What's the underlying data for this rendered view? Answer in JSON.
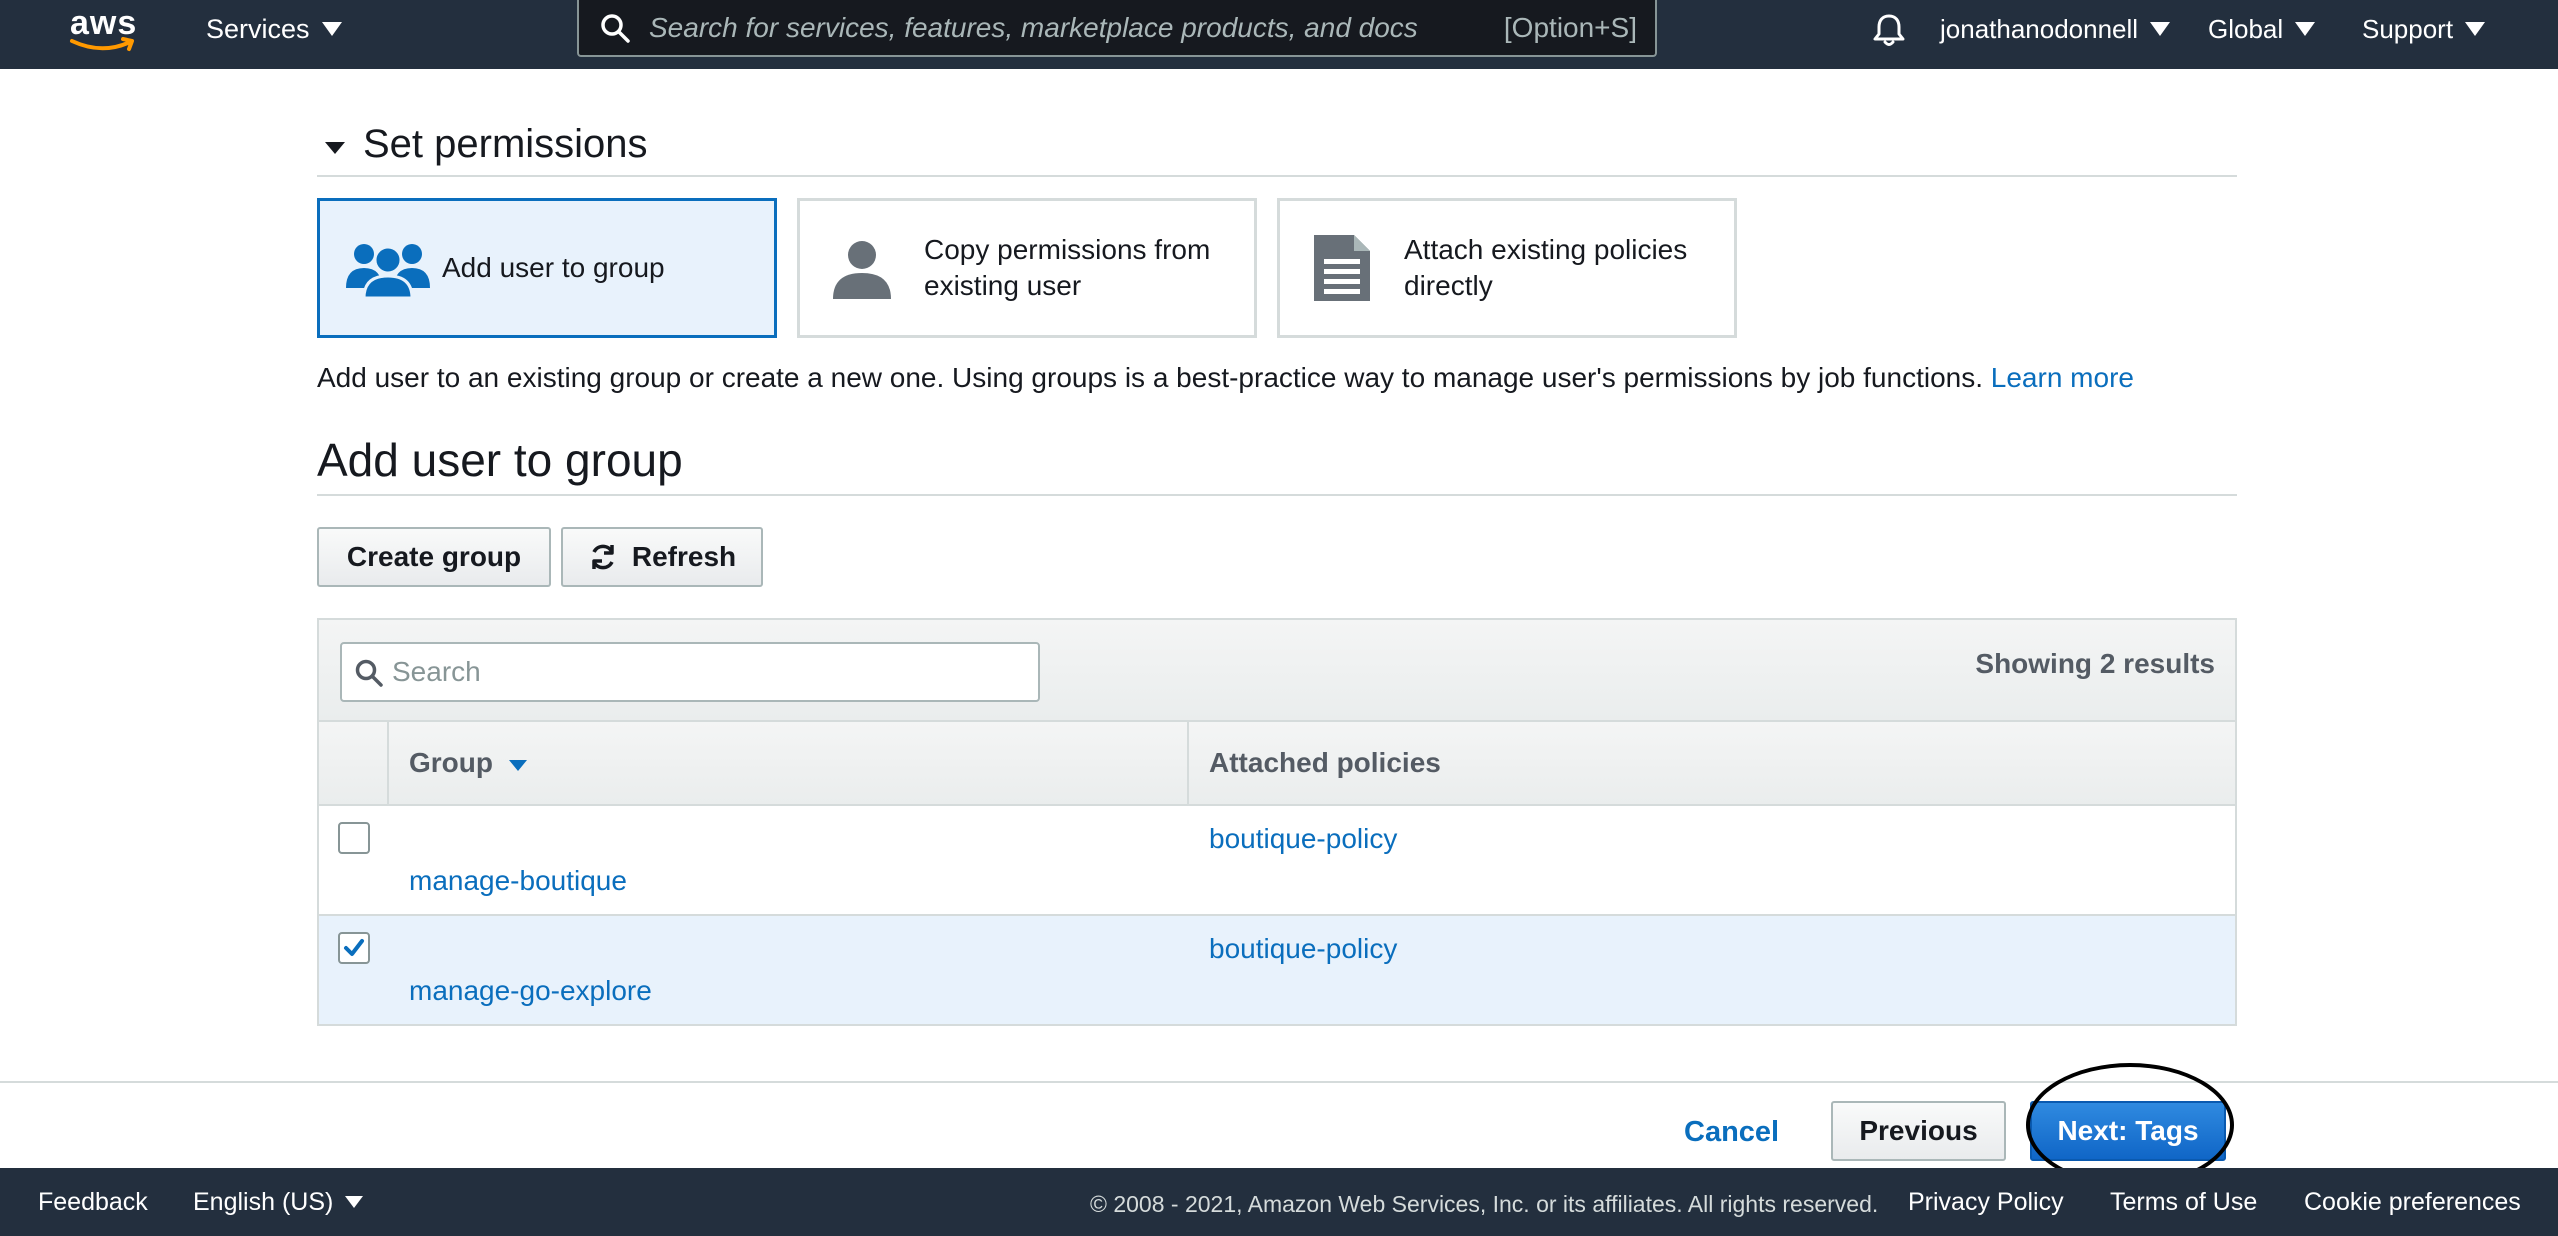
{
  "nav": {
    "logo_text": "aws",
    "services_label": "Services",
    "search_placeholder": "Search for services, features, marketplace products, and docs",
    "search_shortcut": "[Option+S]",
    "account_label": "jonathanodonnell",
    "region_label": "Global",
    "support_label": "Support"
  },
  "permissions": {
    "section_title": "Set permissions",
    "options": [
      {
        "label": "Add user to group",
        "icon": "user-group-icon",
        "selected": true
      },
      {
        "label_line1": "Copy permissions from",
        "label_line2": "existing user",
        "icon": "user-icon",
        "selected": false
      },
      {
        "label_line1": "Attach existing policies",
        "label_line2": "directly",
        "icon": "document-icon",
        "selected": false
      }
    ],
    "description": "Add user to an existing group or create a new one. Using groups is a best-practice way to manage user's permissions by job functions.",
    "learn_more": "Learn more"
  },
  "group_section": {
    "title": "Add user to group",
    "create_group_label": "Create group",
    "refresh_label": "Refresh",
    "search_placeholder": "Search",
    "results_label": "Showing 2 results",
    "columns": {
      "group": "Group",
      "policies": "Attached policies"
    },
    "rows": [
      {
        "group": "manage-boutique",
        "policy": "boutique-policy",
        "checked": false
      },
      {
        "group": "manage-go-explore",
        "policy": "boutique-policy",
        "checked": true
      }
    ]
  },
  "wizard": {
    "cancel_label": "Cancel",
    "previous_label": "Previous",
    "next_label": "Next: Tags"
  },
  "footer": {
    "feedback": "Feedback",
    "language": "English (US)",
    "copyright": "© 2008 - 2021, Amazon Web Services, Inc. or its affiliates. All rights reserved.",
    "privacy": "Privacy Policy",
    "terms": "Terms of Use",
    "cookies": "Cookie preferences"
  },
  "colors": {
    "nav_bg": "#232f3e",
    "link": "#0a6ebd",
    "primary_button": "#1066c7",
    "selected_bg": "#e8f2fc",
    "aws_smile": "#ff9900"
  }
}
